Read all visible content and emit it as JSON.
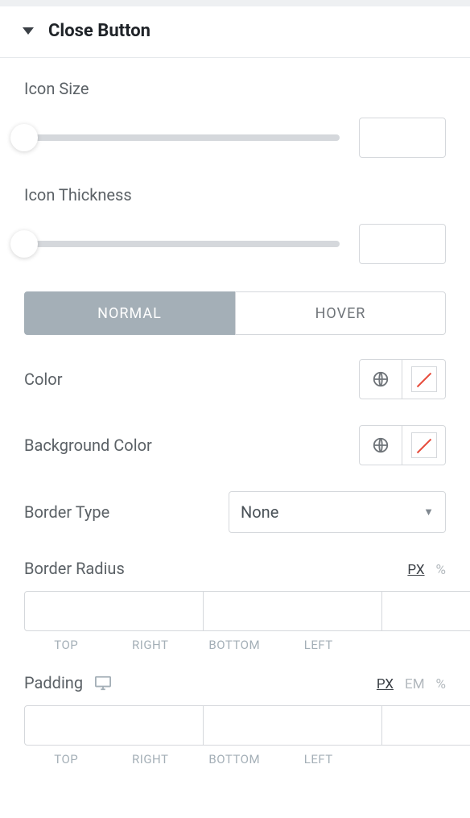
{
  "header": {
    "title": "Close Button"
  },
  "iconSize": {
    "label": "Icon Size",
    "value": ""
  },
  "iconThickness": {
    "label": "Icon Thickness",
    "value": ""
  },
  "tabs": {
    "normal": "NORMAL",
    "hover": "HOVER"
  },
  "color": {
    "label": "Color"
  },
  "backgroundColor": {
    "label": "Background Color"
  },
  "borderType": {
    "label": "Border Type",
    "value": "None"
  },
  "borderRadius": {
    "label": "Border Radius",
    "units": {
      "px": "PX",
      "pct": "%"
    },
    "sides": {
      "top": "TOP",
      "right": "RIGHT",
      "bottom": "BOTTOM",
      "left": "LEFT"
    },
    "values": {
      "top": "",
      "right": "",
      "bottom": "",
      "left": ""
    }
  },
  "padding": {
    "label": "Padding",
    "units": {
      "px": "PX",
      "em": "EM",
      "pct": "%"
    },
    "sides": {
      "top": "TOP",
      "right": "RIGHT",
      "bottom": "BOTTOM",
      "left": "LEFT"
    },
    "values": {
      "top": "",
      "right": "",
      "bottom": "",
      "left": ""
    }
  }
}
